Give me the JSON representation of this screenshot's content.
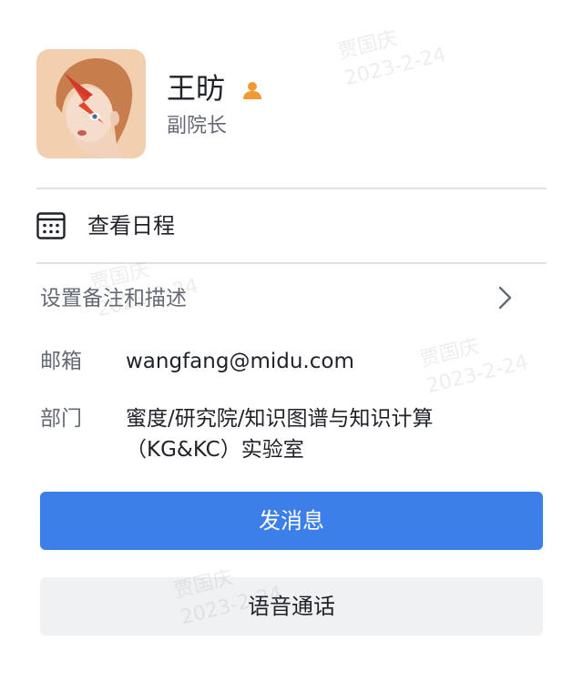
{
  "profile": {
    "name": "王昉",
    "title": "副院长",
    "leader_icon": "person-leader-icon"
  },
  "calendar": {
    "label": "查看日程",
    "icon": "calendar-icon"
  },
  "remark": {
    "label": "设置备注和描述",
    "icon": "chevron-right-icon"
  },
  "info": {
    "email_label": "邮箱",
    "email_value": "wangfang@midu.com",
    "dept_label": "部门",
    "dept_value": "蜜度/研究院/知识图谱与知识计算（KG&KC）实验室"
  },
  "actions": {
    "message_label": "发消息",
    "voice_call_label": "语音通话"
  },
  "watermark": {
    "name": "贾国庆",
    "date": "2023-2-24"
  },
  "colors": {
    "primary": "#3d7fe9",
    "leader_icon": "#f09a37",
    "text_primary": "#1f2329",
    "text_secondary": "#646a73",
    "divider": "#dee0e3",
    "secondary_button": "#f0f1f2"
  }
}
